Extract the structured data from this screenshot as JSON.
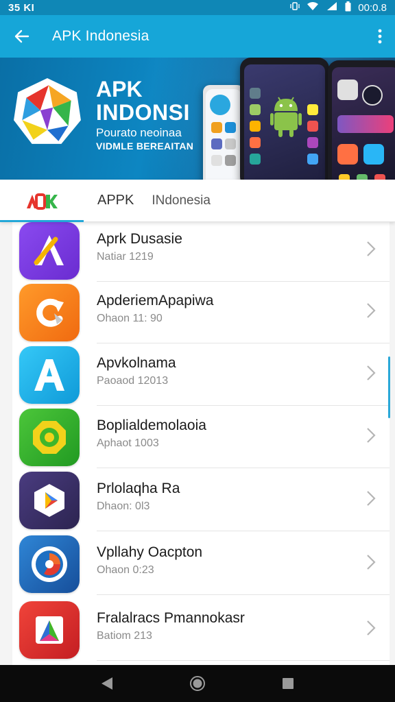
{
  "status_bar": {
    "left_text": "35 KI",
    "time": "00:0.8"
  },
  "app_bar": {
    "title": "APK Indonesia"
  },
  "banner": {
    "title_line1": "APK",
    "title_line2": "INDONSI",
    "subtitle_line1": "Pourato neoinaa",
    "subtitle_line2": "VIDMLE BEREAITAN"
  },
  "tabs": {
    "label1": "APPK",
    "label2": "INdonesia"
  },
  "apps": [
    {
      "title": "Aprk Dusasie",
      "subtitle": "Natiar 1219",
      "color": "#7b3fe0",
      "icon": "letter-a-icon"
    },
    {
      "title": "ApderiemApapiwa",
      "subtitle": "Ohaon 11: 90",
      "color": "#f07c1c",
      "icon": "refresh-c-icon"
    },
    {
      "title": "Apvkolnama",
      "subtitle": "Paoaod 12013",
      "color": "#19b4f0",
      "icon": "letter-a-icon"
    },
    {
      "title": "Boplialdemolaoia",
      "subtitle": "Aphaot 1003",
      "color": "#3fb62b",
      "icon": "gear-ring-icon"
    },
    {
      "title": "Prlolaqha Ra",
      "subtitle": "Dhaon: 0l3",
      "color": "#3b2f66",
      "icon": "play-triangle-icon"
    },
    {
      "title": "Vpllahy Oacpton",
      "subtitle": "Ohaon 0:23",
      "color": "#1e6fc2",
      "icon": "swirl-circle-icon"
    },
    {
      "title": "Fralalracs Pmannokasr",
      "subtitle": "Batiom 213",
      "color": "#e4332e",
      "icon": "colorful-triangle-icon"
    }
  ]
}
